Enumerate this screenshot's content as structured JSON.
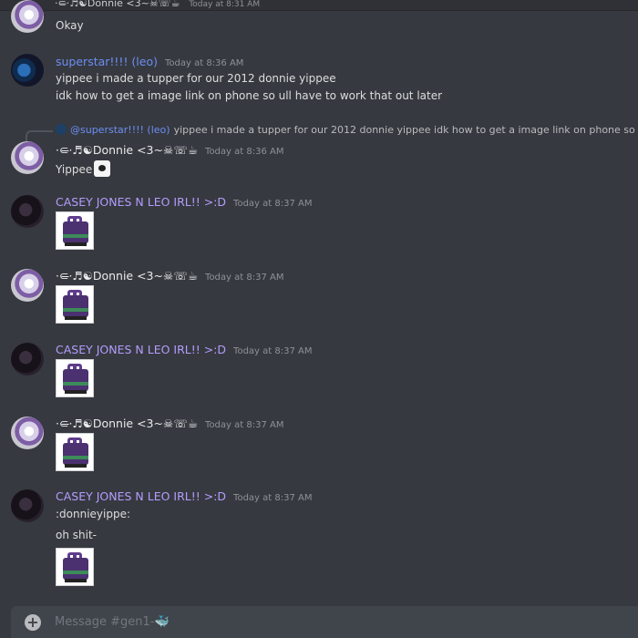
{
  "top": {
    "name": "·⊂̶·♬☯Donnie <3~☠︎☏☕",
    "time": "Today at 8:31 AM",
    "text": "Okay"
  },
  "messages": [
    {
      "author": "superstar!!!! (leo)",
      "time": "Today at 8:36 AM",
      "lines": [
        "yippee i made a tupper for our 2012 donnie yippee",
        "idk how to get a image link on phone so ull have to work that out later"
      ]
    },
    {
      "reply": {
        "author": "@superstar!!!! (leo)",
        "text": "yippee i made a tupper for our 2012 donnie yippee  idk how to get a image link on phone so ull have to work that out later"
      },
      "author": "·⊂̶·♬☯Donnie <3~☠︎☏☕",
      "time": "Today at 8:36 AM",
      "text": "Yippee"
    },
    {
      "author": "CASEY JONES N LEO IRL!! >:D",
      "time": "Today at 8:37 AM"
    },
    {
      "author": "·⊂̶·♬☯Donnie <3~☠︎☏☕",
      "time": "Today at 8:37 AM"
    },
    {
      "author": "CASEY JONES N LEO IRL!! >:D",
      "time": "Today at 8:37 AM"
    },
    {
      "author": "·⊂̶·♬☯Donnie <3~☠︎☏☕",
      "time": "Today at 8:37 AM"
    },
    {
      "author": "CASEY JONES N LEO IRL!! >:D",
      "time": "Today at 8:37 AM",
      "lines": [
        ":donnieyippe:",
        "oh shit-"
      ]
    }
  ],
  "composer": {
    "placeholder": "Message #gen1-🐳"
  },
  "icons": {
    "plus": "add-attachment-icon",
    "emoji": "yippee-emoji-icon",
    "sticker": "donnie-sticker-image"
  },
  "colors": {
    "background": "#36393f",
    "name_leo": "#6c8ef5",
    "name_casey": "#b49cff",
    "timestamp": "#8e9297"
  }
}
